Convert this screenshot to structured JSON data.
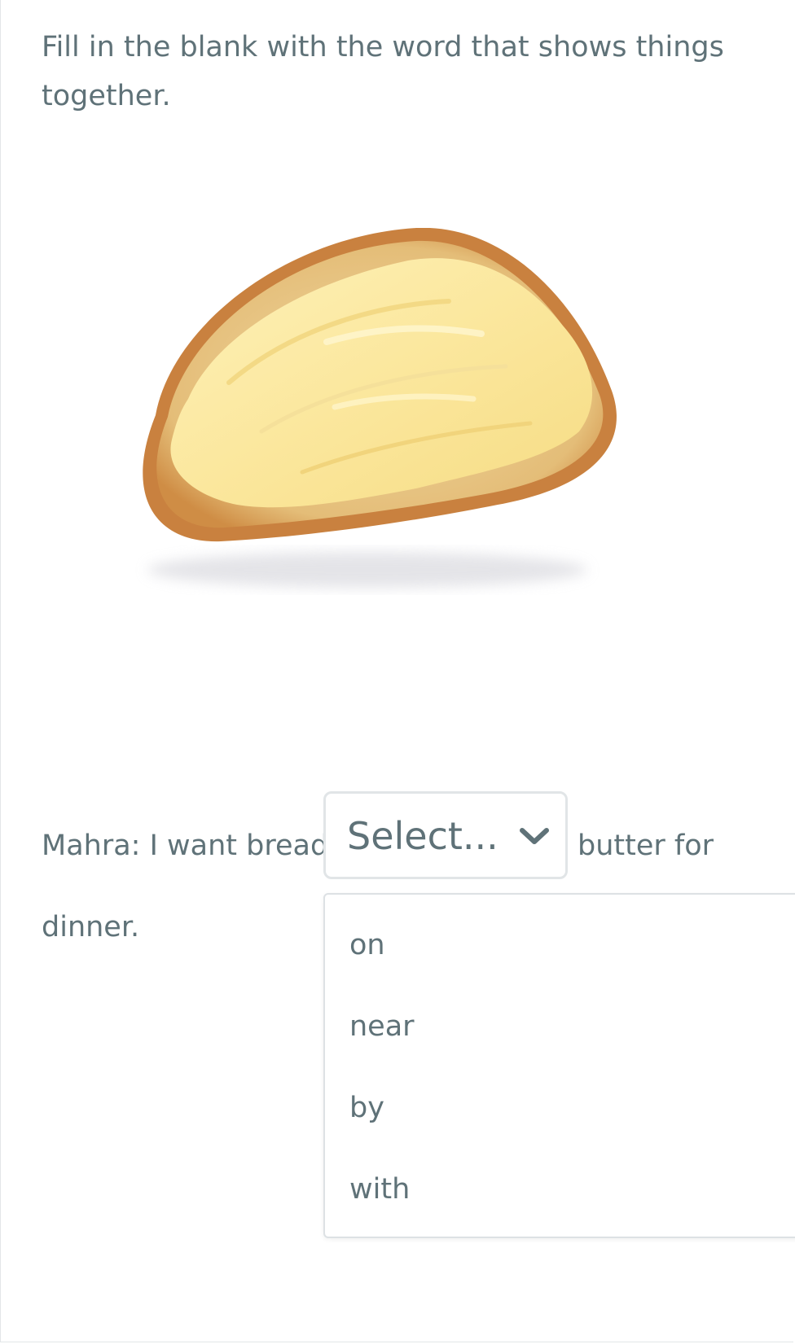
{
  "question": {
    "prompt": "Fill in the blank with the word that shows things together."
  },
  "illustration": {
    "icon": "bread-with-butter-image"
  },
  "sentence": {
    "lead": "Mahra: I want bread",
    "tail": "butter for",
    "line2": "dinner."
  },
  "select": {
    "value": "Select...",
    "icon": "chevron-down-icon",
    "options": [
      "on",
      "near",
      "by",
      "with"
    ]
  },
  "colors": {
    "text": "#5f7278",
    "border": "#e1e5e7"
  }
}
